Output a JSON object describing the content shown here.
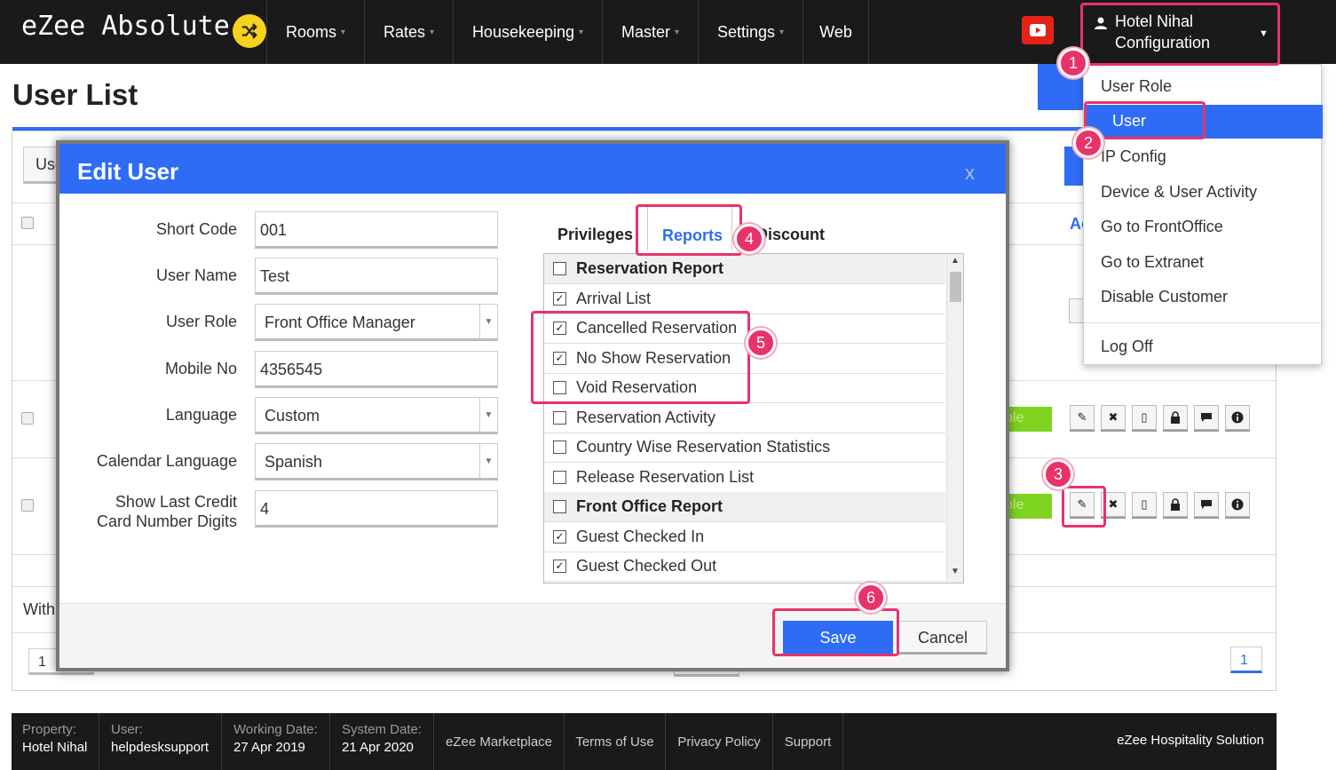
{
  "app": {
    "brand": "eZee Absolute",
    "nav": [
      "Rooms",
      "Rates",
      "Housekeeping",
      "Master",
      "Settings",
      "Web"
    ],
    "hotel_menu": {
      "line1": "Hotel Nihal",
      "line2": "Configuration"
    }
  },
  "config_menu": {
    "items": [
      "User Role",
      "User",
      "IP Config",
      "Device & User Activity",
      "Go to FrontOffice",
      "Go to Extranet",
      "Disable Customer"
    ],
    "logoff": "Log Off",
    "active": "User"
  },
  "page": {
    "title": "User List",
    "partial_labels": {
      "use_btn": "Use",
      "with": "With",
      "ac": "Ac",
      "status1": "ble",
      "status2": "ble",
      "page_left": "1",
      "page_right": "1"
    }
  },
  "modal": {
    "title": "Edit User",
    "close": "x",
    "fields": {
      "short_code": {
        "label": "Short Code",
        "value": "001"
      },
      "user_name": {
        "label": "User Name",
        "value": "Test"
      },
      "user_role": {
        "label": "User Role",
        "value": "Front Office Manager"
      },
      "mobile_no": {
        "label": "Mobile No",
        "value": "4356545"
      },
      "language": {
        "label": "Language",
        "value": "Custom"
      },
      "calendar_language": {
        "label": "Calendar Language",
        "value": "Spanish"
      },
      "last_digits": {
        "label_line1": "Show Last Credit",
        "label_line2": "Card Number Digits",
        "value": "4"
      }
    },
    "tabs": [
      "Privileges",
      "Reports",
      "Discount"
    ],
    "active_tab": "Reports",
    "report_list": [
      {
        "label": "Reservation Report",
        "checked": false,
        "header": true
      },
      {
        "label": "Arrival List",
        "checked": true,
        "header": false
      },
      {
        "label": "Cancelled Reservation",
        "checked": true,
        "header": false
      },
      {
        "label": "No Show Reservation",
        "checked": true,
        "header": false
      },
      {
        "label": "Void Reservation",
        "checked": false,
        "header": false
      },
      {
        "label": "Reservation Activity",
        "checked": false,
        "header": false
      },
      {
        "label": "Country Wise Reservation Statistics",
        "checked": false,
        "header": false
      },
      {
        "label": "Release Reservation List",
        "checked": false,
        "header": false
      },
      {
        "label": "Front Office Report",
        "checked": false,
        "header": true
      },
      {
        "label": "Guest Checked In",
        "checked": true,
        "header": false
      },
      {
        "label": "Guest Checked Out",
        "checked": true,
        "header": false
      }
    ],
    "save_label": "Save",
    "cancel_label": "Cancel"
  },
  "annotations": [
    "1",
    "2",
    "3",
    "4",
    "5",
    "6"
  ],
  "footer": {
    "property_label": "Property:",
    "property_value": "Hotel Nihal",
    "user_label": "User:",
    "user_value": "helpdesksupport",
    "working_label": "Working Date:",
    "working_value": "27 Apr 2019",
    "system_label": "System Date:",
    "system_value": "21 Apr 2020",
    "links": [
      "eZee Marketplace",
      "Terms of Use",
      "Privacy Policy",
      "Support"
    ],
    "right": "eZee Hospitality Solution"
  },
  "colors": {
    "accent": "#2e6cf5",
    "highlight": "#e8336a",
    "status_green": "#7ed321",
    "topbar": "#1a1a1a"
  },
  "icons": [
    "shuffle-icon",
    "youtube-icon",
    "user-icon",
    "pencil-icon",
    "delete-icon",
    "device-icon",
    "lock-icon",
    "message-icon",
    "info-icon"
  ]
}
